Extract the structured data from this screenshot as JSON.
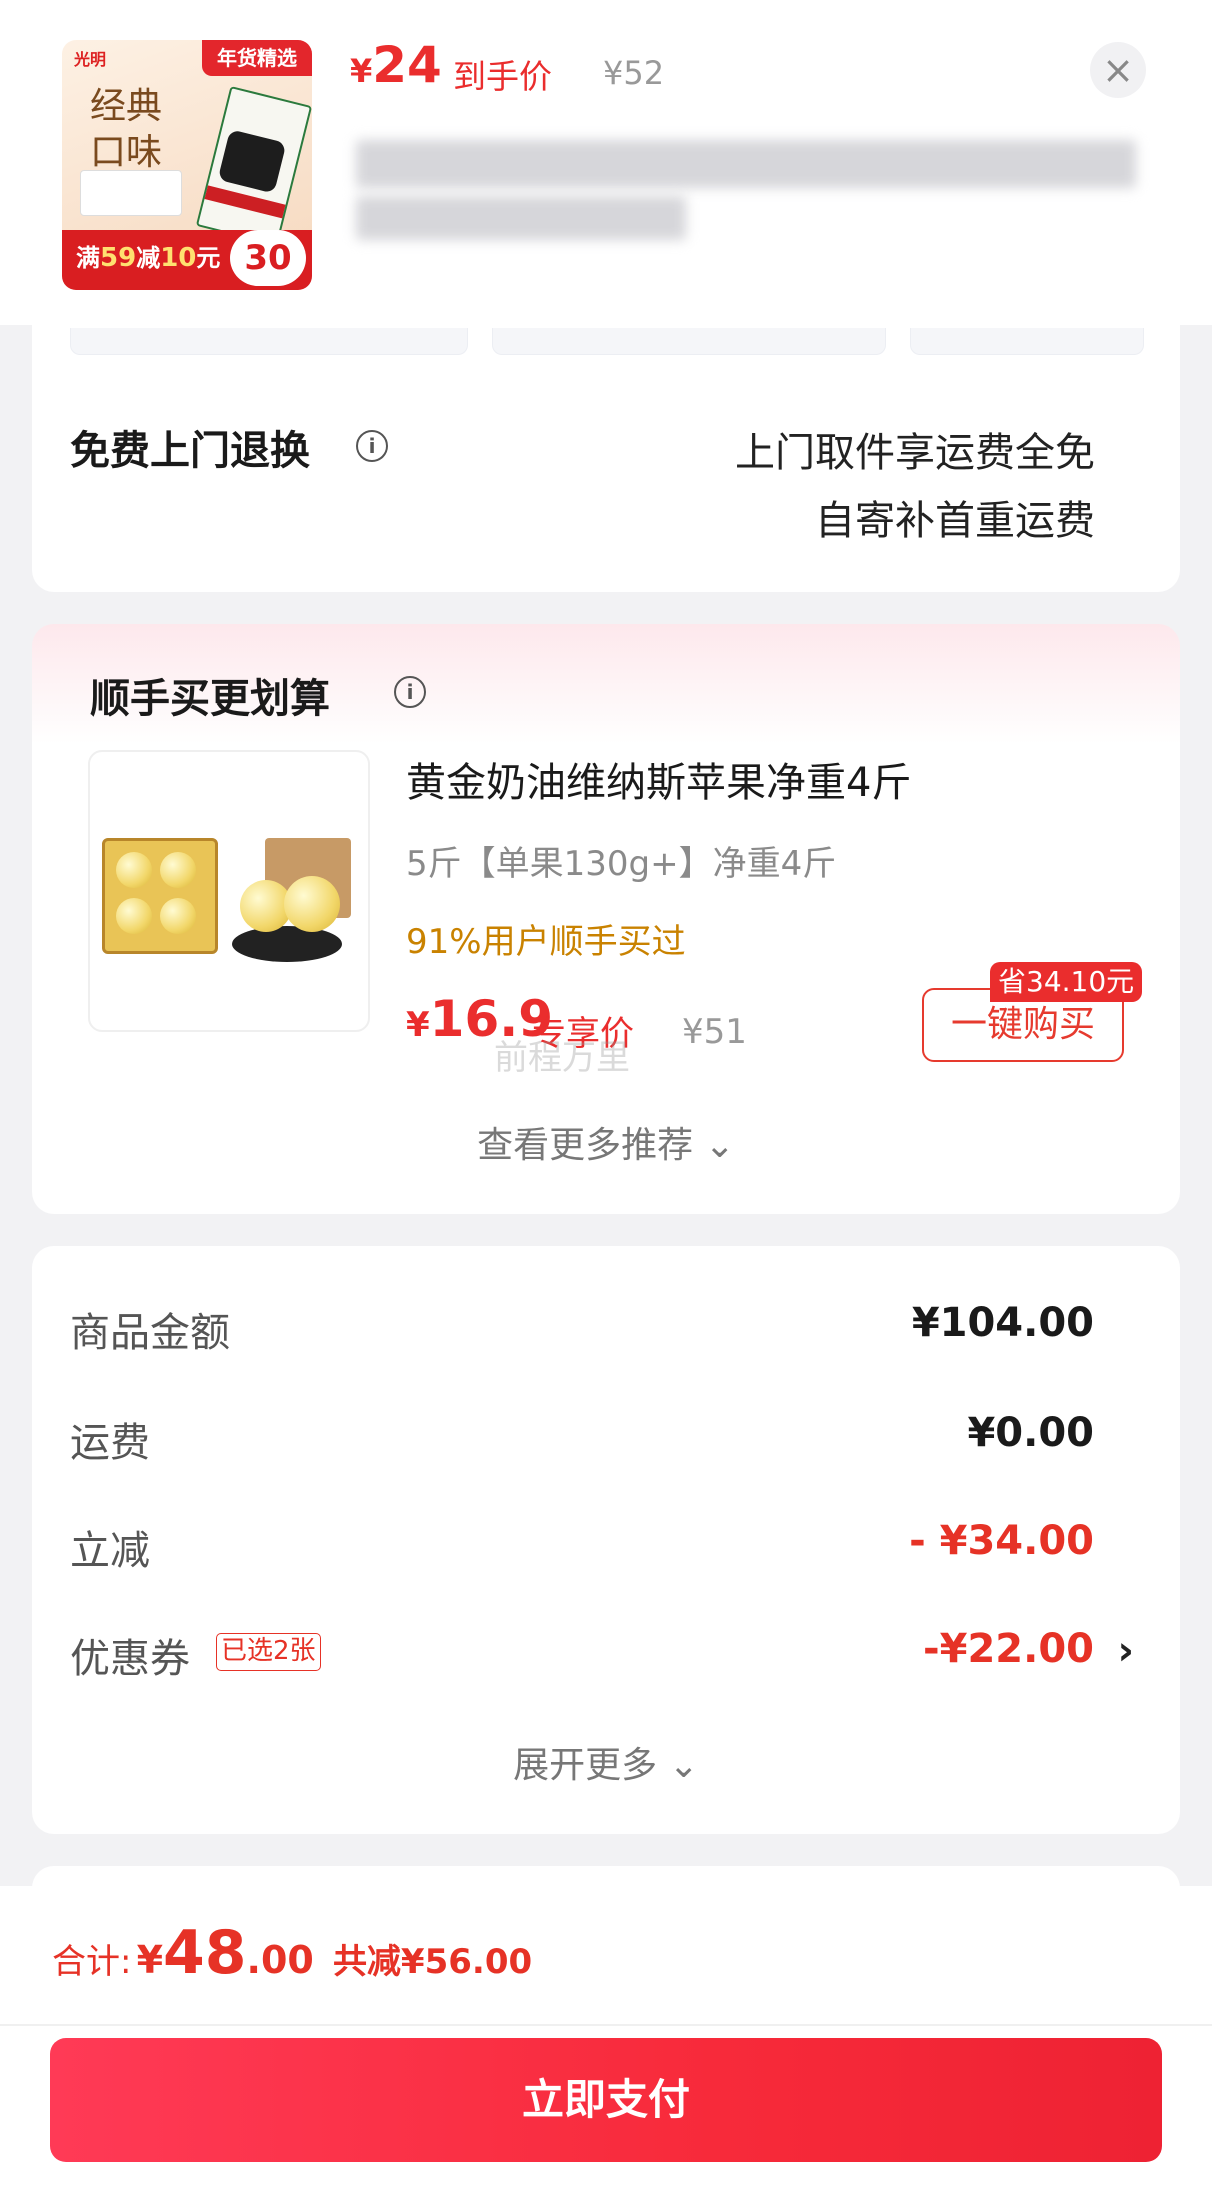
{
  "header": {
    "price_currency": "¥",
    "price_value": "24",
    "price_tag": "到手价",
    "price_original": "¥52",
    "close_icon": "close-icon",
    "thumb": {
      "brand": "光明",
      "top_tag": "年货精选",
      "classic_line1": "经典",
      "classic_line2": "口味",
      "promo_prefix": "满",
      "promo_a": "59",
      "promo_mid": "减",
      "promo_b": "10",
      "promo_suffix": "元",
      "circle_price": "30"
    }
  },
  "return_service": {
    "title": "免费上门退换",
    "line1": "上门取件享运费全免",
    "line2": "自寄补首重运费"
  },
  "recommend": {
    "title": "顺手买更划算",
    "product_name": "黄金奶油维纳斯苹果净重4斤",
    "spec": "5斤【单果130g+】净重4斤",
    "bought": "91%用户顺手买过",
    "price_currency": "¥",
    "price_value": "16.9",
    "price_tag": "专享价",
    "price_original": "¥51",
    "save_badge": "省34.10元",
    "buy_button": "一键购买",
    "more": "查看更多推荐",
    "watermark": "前程万里"
  },
  "summary": {
    "rows": [
      {
        "label": "商品金额",
        "value": "¥104.00"
      },
      {
        "label": "运费",
        "value": "¥0.00"
      },
      {
        "label": "立减",
        "value": "- ¥34.00"
      },
      {
        "label": "优惠券",
        "value": "-¥22.00"
      }
    ],
    "coupon_chip": "已选2张",
    "expand": "展开更多"
  },
  "footer": {
    "total_label": "合计:",
    "total_currency": "¥",
    "total_int": "48",
    "total_dec": ".00",
    "total_saved": "共减¥56.00",
    "pay_button": "立即支付"
  },
  "colors": {
    "accent_red": "#ea2d2d",
    "pay_gradient_start": "#ff3a56",
    "pay_gradient_end": "#ee2233",
    "bought_orange": "#c98200"
  }
}
